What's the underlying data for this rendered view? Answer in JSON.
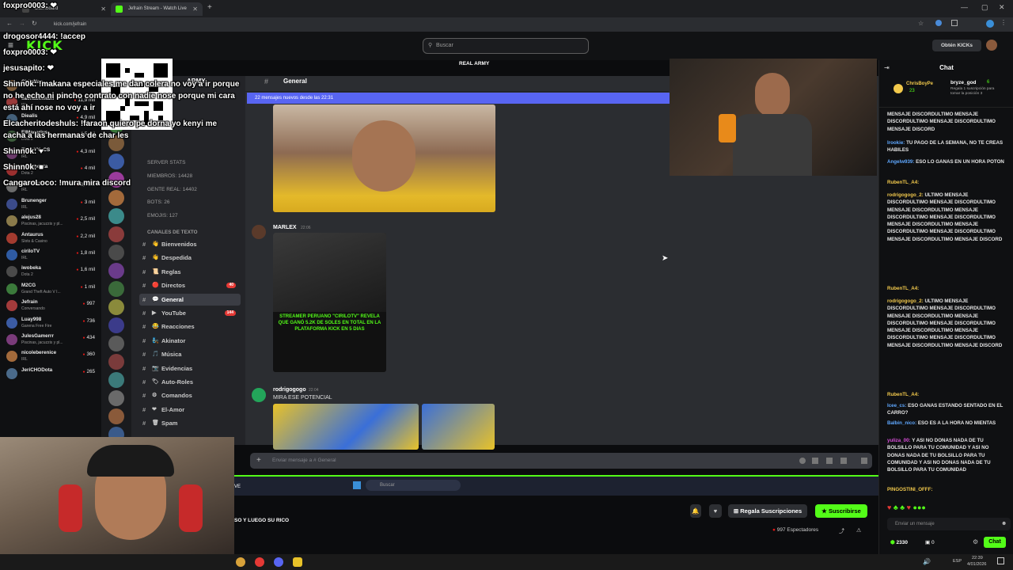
{
  "browser": {
    "tabs": [
      {
        "label": "Dashboard",
        "active": false
      },
      {
        "label": "Jefrain Stream - Watch Live",
        "active": true
      }
    ],
    "new_tab": "+",
    "url": "kick.com/jefrain",
    "window_controls": [
      "—",
      "▢",
      "✕"
    ]
  },
  "kick": {
    "logo": "KICK",
    "search_placeholder": "Buscar",
    "get_kicks": "Obtén KICKs"
  },
  "sidebar": {
    "channels": [
      {
        "name": "ChilaNaa",
        "sub": "",
        "viewers": "",
        "color": "#7a5a3a"
      },
      {
        "name": "sachaueimaki",
        "sub": "IRL",
        "viewers": "11,9 mil",
        "color": "#9b3b3b"
      },
      {
        "name": "Diealis",
        "sub": "IRL",
        "viewers": "4,9 mil",
        "color": "#44607a"
      },
      {
        "name": "ElMacarius",
        "sub": "Dota 2",
        "viewers": "4,5 mil",
        "color": "#3b5b3b"
      },
      {
        "name": "ZULLYY_CS",
        "sub": "IRL",
        "viewers": "4,3 mil",
        "color": "#6a3b6a"
      },
      {
        "name": "smashdota",
        "sub": "Dota 2",
        "viewers": "4 mil",
        "color": "#9b2f2f"
      },
      {
        "name": "EmetSuki",
        "sub": "IRL",
        "viewers": "3,7 mil",
        "color": "#6b6b6b"
      },
      {
        "name": "Brunenger",
        "sub": "IRL",
        "viewers": "3 mil",
        "color": "#3b4b8a"
      },
      {
        "name": "alejus28",
        "sub": "Piscinas, jacuzzis y pl...",
        "viewers": "2,5 mil",
        "color": "#8a7a4a"
      },
      {
        "name": "Antaurus",
        "sub": "Slots & Casino",
        "viewers": "2,2 mil",
        "color": "#a33b2f"
      },
      {
        "name": "ciriloTV",
        "sub": "IRL",
        "viewers": "1,8 mil",
        "color": "#2f5ba3"
      },
      {
        "name": "iwobeka",
        "sub": "Dota 2",
        "viewers": "1,6 mil",
        "color": "#4a4a4a"
      },
      {
        "name": "M2CG",
        "sub": "Grand Theft Auto V I...",
        "viewers": "1 mil",
        "color": "#3b7a3b"
      },
      {
        "name": "Jefrain",
        "sub": "Conversando",
        "viewers": "997",
        "color": "#a33b3b"
      },
      {
        "name": "Luay998",
        "sub": "Garena Free Fire",
        "viewers": "736",
        "color": "#3b5ba3"
      },
      {
        "name": "JulesGamerrr",
        "sub": "Piscinas, jacuzzis y pl...",
        "viewers": "434",
        "color": "#7a3b7a"
      },
      {
        "name": "nicoleberenice",
        "sub": "IRL",
        "viewers": "360",
        "color": "#a36a3b"
      },
      {
        "name": "JeriCHODota",
        "sub": "",
        "viewers": "265",
        "color": "#4a6a8a"
      }
    ]
  },
  "overlay_chat": [
    {
      "user": "foxpro0003:",
      "text": "❤"
    },
    {
      "user": "drogosor4444:",
      "text": "!accep"
    },
    {
      "user": "foxpro0003:",
      "text": "❤"
    },
    {
      "user": "jesusapito:",
      "text": "❤"
    },
    {
      "user": "Shinn0k:",
      "text": "!makana especiales me dan colera no voy a ir porque"
    },
    {
      "user": "",
      "text": "no he echo ni pincho contrato con nadie nose porque mi cara"
    },
    {
      "user": "",
      "text": "está ahí nose no voy a ir"
    },
    {
      "user": "Elcacheritodeshuls:",
      "text": "!faraon quiero pe dorna yo kenyi me"
    },
    {
      "user": "",
      "text": "cacha a las hermanas de char les"
    },
    {
      "user": "Shinn0k:",
      "text": "♥"
    },
    {
      "user": "Shinn0k:",
      "text": "■"
    },
    {
      "user": "CangaroLoco:",
      "text": "!mura mira discord"
    }
  ],
  "discord": {
    "server_header": "ARMY",
    "banner": "REAL ARMY",
    "channel_title": "General",
    "new_messages": "22 mensajes nuevos desde las 22:31",
    "stats": [
      "SERVER STATS",
      "MIEMBROS: 14428",
      "GENTE REAL: 14402",
      "BOTS: 26",
      "EMOJIS: 127"
    ],
    "category": "CANALES DE TEXTO",
    "channels": [
      {
        "name": "Bienvenidos",
        "emoji": "👋"
      },
      {
        "name": "Despedida",
        "emoji": "👋"
      },
      {
        "name": "Reglas",
        "emoji": "📜"
      },
      {
        "name": "Directos",
        "emoji": "🔴",
        "badge": "40"
      },
      {
        "name": "General",
        "emoji": "💬",
        "selected": true
      },
      {
        "name": "YouTube",
        "emoji": "▶",
        "badge": "144"
      },
      {
        "name": "Reacciones",
        "emoji": "😂"
      },
      {
        "name": "Akinator",
        "emoji": "🧞"
      },
      {
        "name": "Música",
        "emoji": "🎵"
      },
      {
        "name": "Evidencias",
        "emoji": "📷"
      },
      {
        "name": "Auto-Roles",
        "emoji": "🏷"
      },
      {
        "name": "Comandos",
        "emoji": "⚙"
      },
      {
        "name": "El-Amor",
        "emoji": "❤"
      },
      {
        "name": "Spam",
        "emoji": "🗑"
      }
    ],
    "messages": [
      {
        "author": "MARLEX",
        "time": "22:06",
        "image_caption": "STREAMER PERUANO \"CIRILOTV\" REVELA QUE GANÓ 5.2K DE SOLES EN TOTAL EN LA PLATAFORMA KICK EN 5 DIAS"
      },
      {
        "author": "rodrigogogo",
        "time": "22:04",
        "text": "MIRA ESE POTENCIAL"
      }
    ],
    "message_placeholder": "Enviar mensaje a # General"
  },
  "windows_search": "Buscar",
  "stream_info": {
    "title": "SO Y LUEGO SU RICO",
    "gift_subs": "Regala Suscripciones",
    "subscribe": "Suscribirse",
    "viewers": "997 Espectadores"
  },
  "chat": {
    "title": "Chat",
    "pinned_user": "ChrisBoyPe",
    "pinned_count": "23",
    "gift_user": "bryze_god",
    "gift_count": "6",
    "gift_text": "Regala 1 suscripción para tomar la posición 3",
    "messages": [
      {
        "user": "",
        "text": "MENSAJE DISCORDULTIMO MENSAJE DISCORDULTIMO MENSAJE DISCORDULTIMO MENSAJE DISCORD",
        "color": "#ffffff"
      },
      {
        "user": "Irookie:",
        "text": "TU PAGO DE LA SEMANA, NO TE CREAS HABILES",
        "color": "#5fa8ff"
      },
      {
        "user": "Angelw939:",
        "text": "ESO LO GANAS EN UN HORA POTON",
        "color": "#5fa8ff"
      },
      {
        "user": "RubenTL_A4:",
        "text": "",
        "color": "#f2c94c"
      },
      {
        "user": "rodrigogogo_2:",
        "text": "ULTIMO MENSAJE DISCORDULTIMO MENSAJE DISCORDULTIMO MENSAJE DISCORDULTIMO MENSAJE DISCORDULTIMO MENSAJE DISCORDULTIMO MENSAJE DISCORDULTIMO MENSAJE DISCORDULTIMO MENSAJE DISCORDULTIMO MENSAJE DISCORDULTIMO MENSAJE DISCORD",
        "color": "#f2c94c"
      },
      {
        "user": "RubenTL_A4:",
        "text": "",
        "color": "#f2c94c"
      },
      {
        "user": "rodrigogogo_2:",
        "text": "ULTIMO MENSAJE DISCORDULTIMO MENSAJE DISCORDULTIMO MENSAJE DISCORDULTIMO MENSAJE DISCORDULTIMO MENSAJE DISCORDULTIMO MENSAJE DISCORDULTIMO MENSAJE DISCORDULTIMO MENSAJE DISCORDULTIMO MENSAJE DISCORDULTIMO MENSAJE DISCORD",
        "color": "#f2c94c"
      },
      {
        "user": "RubenTL_A4:",
        "text": "",
        "color": "#f2c94c"
      },
      {
        "user": "Icee_cs:",
        "text": "ESO GANAS ESTANDO SENTADO EN EL CARRO?",
        "color": "#5fa8ff"
      },
      {
        "user": "Balbin_nico:",
        "text": "ESO ES A LA HORA NO MIENTAS",
        "color": "#5fa8ff"
      },
      {
        "user": "yuliza_00:",
        "text": "Y ASI NO DONAS NADA DE TU BOLSILLO PARA TU COMUNIDAD Y ASI NO DONAS NADA DE TU BOLSILLO PARA TU COMUNIDAD Y ASI NO DONAS NADA DE TU BOLSILLO PARA TU COMUNIDAD",
        "color": "#d94fd9"
      },
      {
        "user": "PINGOSTINI_OFFF:",
        "text": "",
        "color": "#f2c94c"
      }
    ],
    "input_placeholder": "Enviar un mensaje",
    "points": "2330",
    "zero": "0",
    "chat_button": "Chat"
  },
  "taskbar": {
    "lang": "ESP",
    "time": "22:39",
    "date": "4/01/2026"
  }
}
